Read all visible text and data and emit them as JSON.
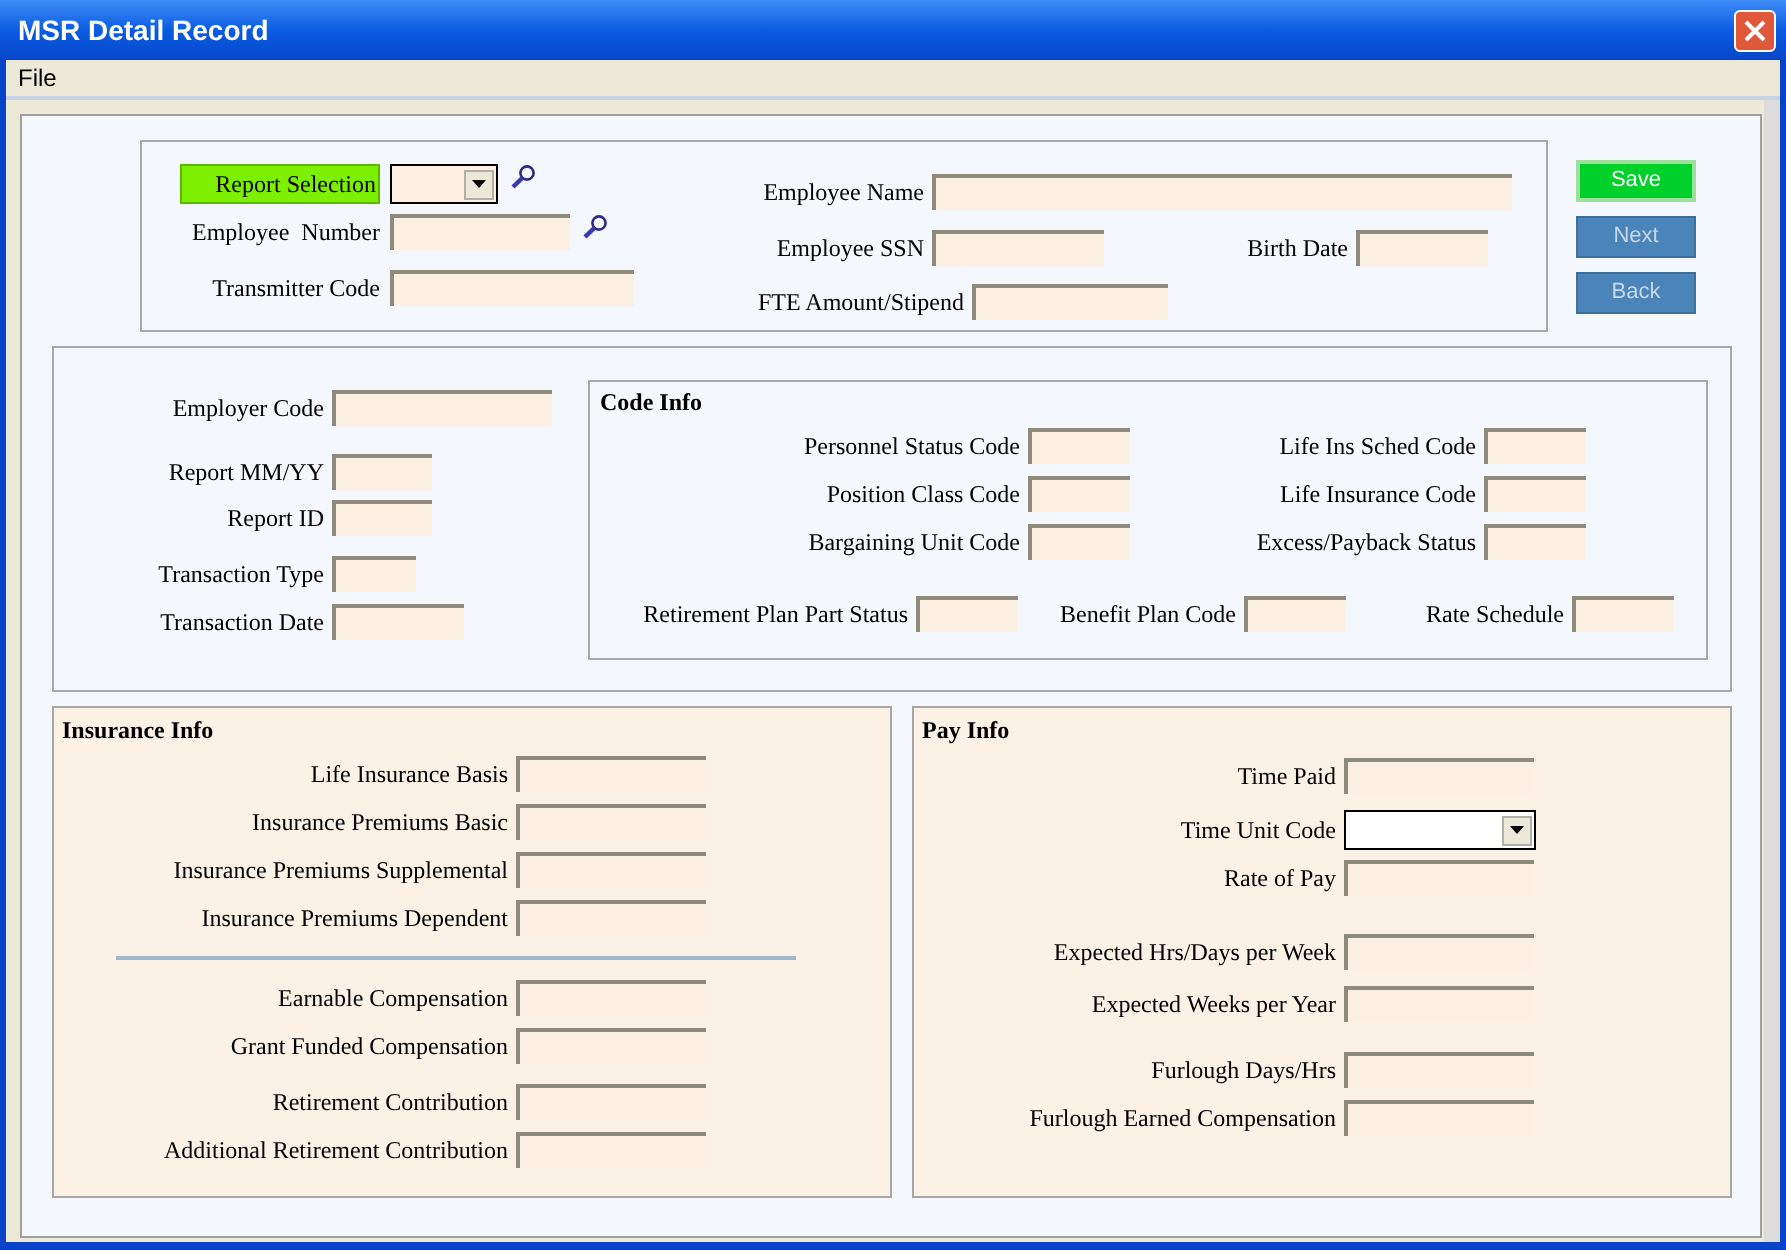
{
  "window": {
    "title": "MSR Detail Record"
  },
  "menu": [
    {
      "label": "File"
    }
  ],
  "header": {
    "left": [
      {
        "label": "Report Selection",
        "kind": "combo",
        "highlighted": true,
        "lookup": true
      },
      {
        "label": "Employee  Number",
        "kind": "text",
        "highlighted": false,
        "lookup": true
      },
      {
        "label": "Transmitter Code",
        "kind": "text",
        "highlighted": false,
        "lookup": false
      }
    ],
    "right": [
      {
        "label": "Employee Name"
      },
      {
        "label": "Employee SSN"
      },
      {
        "label": "FTE Amount/Stipend"
      }
    ],
    "birth_date": {
      "label": "Birth Date"
    }
  },
  "buttons": [
    {
      "label": "Save",
      "disabled": false
    },
    {
      "label": "Next",
      "disabled": true
    },
    {
      "label": "Back",
      "disabled": true
    }
  ],
  "record": {
    "fields": [
      {
        "label": "Employer Code"
      },
      {
        "label": "Report MM/YY"
      },
      {
        "label": "Report ID"
      },
      {
        "label": "Transaction Type"
      },
      {
        "label": "Transaction Date"
      }
    ]
  },
  "code_info": {
    "title": "Code Info",
    "left": [
      {
        "label": "Personnel Status Code"
      },
      {
        "label": "Position Class Code"
      },
      {
        "label": "Bargaining Unit Code"
      }
    ],
    "right": [
      {
        "label": "Life Ins Sched Code"
      },
      {
        "label": "Life Insurance Code"
      },
      {
        "label": "Excess/Payback Status"
      }
    ],
    "bottom": [
      {
        "label": "Retirement Plan Part Status"
      },
      {
        "label": "Benefit Plan Code"
      },
      {
        "label": "Rate Schedule"
      }
    ]
  },
  "insurance_info": {
    "title": "Insurance Info",
    "groups": [
      {
        "fields": [
          {
            "label": "Life Insurance Basis"
          },
          {
            "label": "Insurance Premiums Basic"
          },
          {
            "label": "Insurance Premiums Supplemental"
          },
          {
            "label": "Insurance Premiums Dependent"
          }
        ]
      },
      {
        "fields": [
          {
            "label": "Earnable Compensation"
          },
          {
            "label": "Grant Funded Compensation"
          },
          {
            "label": "Retirement Contribution"
          },
          {
            "label": "Additional Retirement Contribution"
          }
        ]
      }
    ]
  },
  "pay_info": {
    "title": "Pay Info",
    "fields": [
      {
        "label": "Time Paid",
        "kind": "text"
      },
      {
        "label": "Time Unit Code",
        "kind": "combo"
      },
      {
        "label": "Rate of Pay",
        "kind": "text"
      },
      {
        "label": "Expected Hrs/Days per Week",
        "kind": "text"
      },
      {
        "label": "Expected Weeks per Year",
        "kind": "text"
      },
      {
        "label": "Furlough Days/Hrs",
        "kind": "text"
      },
      {
        "label": "Furlough Earned Compensation",
        "kind": "text"
      }
    ]
  }
}
